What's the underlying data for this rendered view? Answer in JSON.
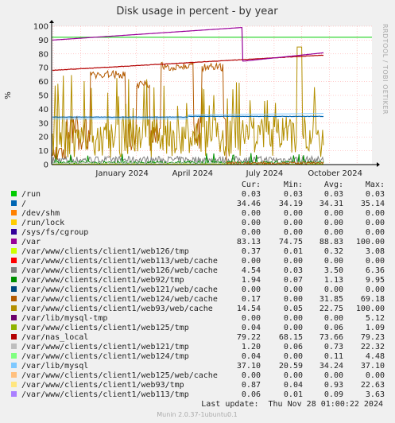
{
  "chart_data": {
    "type": "line",
    "title": "Disk usage in percent - by year",
    "ylabel": "%",
    "ylim": [
      0,
      100
    ],
    "yticks": [
      0,
      10,
      20,
      30,
      40,
      50,
      60,
      70,
      80,
      90,
      100
    ],
    "xlabels": [
      "January 2024",
      "April 2024",
      "July 2024",
      "October 2024"
    ],
    "grid": true,
    "side_label": "RRDTOOL / TOBI OETIKER",
    "columns": [
      "Cur:",
      "Min:",
      "Avg:",
      "Max:"
    ],
    "warning_line": 92,
    "series": [
      {
        "name": "/run",
        "color": "#00cc00",
        "cur": "0.03",
        "min": "0.03",
        "avg": "0.03",
        "max": "0.03"
      },
      {
        "name": "/",
        "color": "#0066b3",
        "cur": "34.46",
        "min": "34.19",
        "avg": "34.31",
        "max": "35.14"
      },
      {
        "name": "/dev/shm",
        "color": "#ff8000",
        "cur": "0.00",
        "min": "0.00",
        "avg": "0.00",
        "max": "0.00"
      },
      {
        "name": "/run/lock",
        "color": "#ffcc00",
        "cur": "0.00",
        "min": "0.00",
        "avg": "0.00",
        "max": "0.00"
      },
      {
        "name": "/sys/fs/cgroup",
        "color": "#330099",
        "cur": "0.00",
        "min": "0.00",
        "avg": "0.00",
        "max": "0.00"
      },
      {
        "name": "/var",
        "color": "#990099",
        "cur": "83.13",
        "min": "74.75",
        "avg": "88.83",
        "max": "100.00"
      },
      {
        "name": "/var/www/clients/client1/web126/tmp",
        "color": "#ccff00",
        "cur": "0.37",
        "min": "0.01",
        "avg": "0.32",
        "max": "3.08"
      },
      {
        "name": "/var/www/clients/client1/web113/web/cache",
        "color": "#ff0000",
        "cur": "0.00",
        "min": "0.00",
        "avg": "0.00",
        "max": "0.00"
      },
      {
        "name": "/var/www/clients/client1/web126/web/cache",
        "color": "#808080",
        "cur": "4.54",
        "min": "0.03",
        "avg": "3.50",
        "max": "6.36"
      },
      {
        "name": "/var/www/clients/client1/web92/tmp",
        "color": "#008f00",
        "cur": "1.94",
        "min": "0.07",
        "avg": "1.13",
        "max": "9.95"
      },
      {
        "name": "/var/www/clients/client1/web121/web/cache",
        "color": "#00487d",
        "cur": "0.00",
        "min": "0.00",
        "avg": "0.00",
        "max": "0.00"
      },
      {
        "name": "/var/www/clients/client1/web124/web/cache",
        "color": "#b35a00",
        "cur": "0.17",
        "min": "0.00",
        "avg": "31.85",
        "max": "69.18"
      },
      {
        "name": "/var/www/clients/client1/web93/web/cache",
        "color": "#b38f00",
        "cur": "14.54",
        "min": "0.05",
        "avg": "22.75",
        "max": "100.00"
      },
      {
        "name": "/var/lib/mysql-tmp",
        "color": "#6b006b",
        "cur": "0.00",
        "min": "0.00",
        "avg": "0.00",
        "max": "5.12"
      },
      {
        "name": "/var/www/clients/client1/web125/tmp",
        "color": "#8fb300",
        "cur": "0.04",
        "min": "0.00",
        "avg": "0.06",
        "max": "1.09"
      },
      {
        "name": "/var/nas_local",
        "color": "#b30000",
        "cur": "79.22",
        "min": "68.15",
        "avg": "73.66",
        "max": "79.23"
      },
      {
        "name": "/var/www/clients/client1/web121/tmp",
        "color": "#bebebe",
        "cur": "1.20",
        "min": "0.06",
        "avg": "0.73",
        "max": "22.32"
      },
      {
        "name": "/var/www/clients/client1/web124/tmp",
        "color": "#80ff80",
        "cur": "0.04",
        "min": "0.00",
        "avg": "0.11",
        "max": "4.48"
      },
      {
        "name": "/var/lib/mysql",
        "color": "#80c9ff",
        "cur": "37.10",
        "min": "20.59",
        "avg": "34.24",
        "max": "37.10"
      },
      {
        "name": "/var/www/clients/client1/web125/web/cache",
        "color": "#ffc080",
        "cur": "0.00",
        "min": "0.00",
        "avg": "0.00",
        "max": "0.00"
      },
      {
        "name": "/var/www/clients/client1/web93/tmp",
        "color": "#ffe680",
        "cur": "0.87",
        "min": "0.04",
        "avg": "0.93",
        "max": "22.63"
      },
      {
        "name": "/var/www/clients/client1/web113/tmp",
        "color": "#aa80ff",
        "cur": "0.06",
        "min": "0.01",
        "avg": "0.09",
        "max": "3.63"
      }
    ],
    "last_update": "Last update:  Thu Nov 28 01:00:22 2024",
    "footer": "Munin 2.0.37-1ubuntu0.1"
  }
}
